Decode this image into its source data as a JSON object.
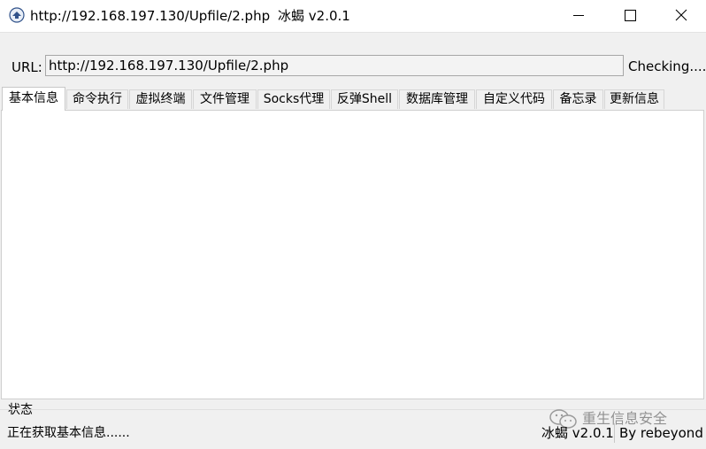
{
  "window": {
    "title_url": "http://192.168.197.130/Upfile/2.php",
    "title_app": "冰蝎 v2.0.1"
  },
  "url_bar": {
    "label": "URL:",
    "value": "http://192.168.197.130/Upfile/2.php",
    "status": "Checking...."
  },
  "tabs": [
    {
      "label": "基本信息",
      "active": true
    },
    {
      "label": "命令执行"
    },
    {
      "label": "虚拟终端"
    },
    {
      "label": "文件管理"
    },
    {
      "label": "Socks代理"
    },
    {
      "label": "反弹Shell"
    },
    {
      "label": "数据库管理"
    },
    {
      "label": "自定义代码"
    },
    {
      "label": "备忘录"
    },
    {
      "label": "更新信息"
    }
  ],
  "status": {
    "title": "状态",
    "text": "正在获取基本信息......",
    "version": "冰蝎 v2.0.1",
    "author": "By rebeyond"
  },
  "watermark": {
    "text": "重生信息安全"
  }
}
